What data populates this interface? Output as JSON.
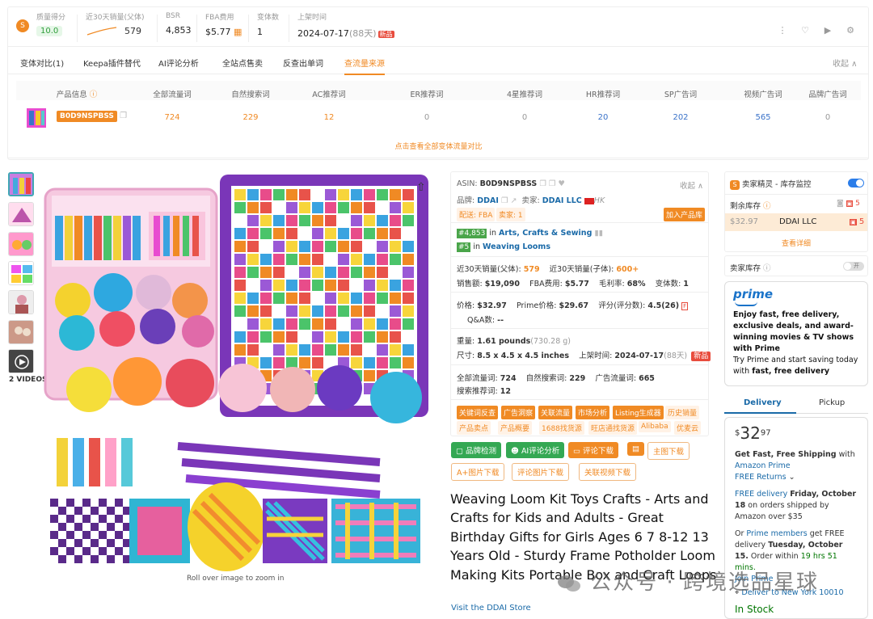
{
  "topbar": {
    "quality_label": "质量得分",
    "quality_value": "10.0",
    "sales_label": "近30天销量(父体)",
    "sales_value": "579",
    "bsr_label": "BSR",
    "bsr_value": "4,853",
    "fba_label": "FBA费用",
    "fba_value": "$5.77",
    "variants_label": "变体数",
    "variants_value": "1",
    "launch_label": "上架时间",
    "launch_value": "2024-07-17",
    "launch_days": "(88天)",
    "new_tag": "新品"
  },
  "tabs": [
    {
      "label": "变体对比(1)"
    },
    {
      "label": "Keepa插件替代"
    },
    {
      "label": "AI评论分析"
    },
    {
      "label": "全站点售卖"
    },
    {
      "label": "反查出单词"
    },
    {
      "label": "查流量来源"
    }
  ],
  "collapse_label": "收起",
  "traffic": {
    "headers": [
      "产品信息",
      "全部流量词",
      "自然搜索词",
      "AC推荐词",
      "ER推荐词",
      "4星推荐词",
      "HR推荐词",
      "SP广告词",
      "视频广告词",
      "品牌广告词"
    ],
    "asin": "B0D9NSPBSS",
    "values": [
      "724",
      "229",
      "12",
      "0",
      "0",
      "20",
      "202",
      "565",
      "0"
    ],
    "view_all": "点击查看全部变体流量对比"
  },
  "thumbs": {
    "video_label": "2 VIDEOS"
  },
  "image_caption": "Roll over image to zoom in",
  "info": {
    "asin_label": "ASIN:",
    "asin": "B0D9NSPBSS",
    "collapse": "收起",
    "brand_label": "品牌:",
    "brand": "DDAI",
    "seller_label": "卖家:",
    "seller": "DDAI LLC",
    "seller_region": "HK",
    "ship_tag": "配送: FBA",
    "sellers_tag": "卖家: 1",
    "add_product": "加入产品库",
    "rank1": "#4,853",
    "rank1_in": "in",
    "rank1_cat": "Arts, Crafts & Sewing",
    "rank2": "#5",
    "rank2_in": "in",
    "rank2_cat": "Weaving Looms",
    "sales_parent_label": "近30天销量(父体):",
    "sales_parent": "579",
    "sales_child_label": "近30天销量(子体):",
    "sales_child": "600+",
    "revenue_label": "销售额:",
    "revenue": "$19,090",
    "fba_label": "FBA费用:",
    "fba": "$5.77",
    "margin_label": "毛利率:",
    "margin": "68%",
    "variants_label": "变体数:",
    "variants": "1",
    "price_label": "价格:",
    "price": "$32.97",
    "prime_price_label": "Prime价格:",
    "prime_price": "$29.67",
    "rating_label": "评分(评分数):",
    "rating": "4.5(26)",
    "qa_label": "Q&A数:",
    "qa": "--",
    "weight_label": "重量:",
    "weight": "1.61 pounds",
    "weight_g": "(730.28 g)",
    "size_label": "尺寸:",
    "size": "8.5 x 4.5 x 4.5 inches",
    "launch_label": "上架时间:",
    "launch": "2024-07-17",
    "launch_days": "(88天)",
    "new_tag": "新品",
    "all_kw_label": "全部流量词:",
    "all_kw": "724",
    "organic_label": "自然搜索词:",
    "organic": "229",
    "ad_label": "广告流量词:",
    "ad": "665",
    "rec_label": "搜索推荐词:",
    "rec": "12",
    "tools_row1": [
      "关键词反查",
      "广告洞察",
      "关联流量",
      "市场分析",
      "Listing生成器",
      "历史销量"
    ],
    "tools_row2": [
      "产品卖点",
      "产品概要",
      "1688找货源",
      "旺店通找货源",
      "Alibaba",
      "优麦云"
    ]
  },
  "actions": {
    "brand_check": "品牌检测",
    "ai_review": "AI评论分析",
    "review_dl": "评论下载",
    "main_img_dl": "主图下载",
    "aplus_dl": "A+图片下载",
    "review_img_dl": "评论图片下载",
    "video_dl": "关联视频下载"
  },
  "product_title": "Weaving Loom Kit Toys Crafts - Arts and Crafts for Kids and Adults - Great Birthday Gifts for Girls Ages 6 7 8-12 13 Years Old - Sturdy Frame Potholder Loom Making Kits Portable Box and Craft Loops",
  "store_link": "Visit the DDAI Store",
  "right": {
    "monitor_label": "卖家精灵 - 库存监控",
    "stock_label": "剩余库存",
    "stock_count": "5",
    "row_price": "$32.97",
    "row_seller": "DDAI LLC",
    "row_count": "5",
    "view_detail": "查看详细",
    "seller_stock_label": "卖家库存",
    "toggle_label": "开"
  },
  "prime": {
    "logo": "prime",
    "line1": "Enjoy fast, free delivery, exclusive deals, and award-winning movies & TV shows with Prime",
    "line2": "Try Prime and start saving today with",
    "line2_bold": "fast, free delivery"
  },
  "buybox": {
    "tab_delivery": "Delivery",
    "tab_pickup": "Pickup",
    "currency": "$",
    "price_whole": "32",
    "price_frac": "97",
    "free_ship": "Get Fast, Free Shipping",
    "with": "with",
    "amazon_prime": "Amazon Prime",
    "free_returns": "FREE Returns",
    "free_delivery": "FREE delivery",
    "date1": "Friday, October 18",
    "ship_cond": "on orders shipped by Amazon over $35",
    "or": "Or",
    "prime_members": "Prime members",
    "get_free": "get FREE delivery",
    "date2": "Tuesday, October 15.",
    "order_within": "Order within",
    "countdown": "19 hrs 51 mins.",
    "join_prime": "Join Prime",
    "deliver_to": "Deliver to New York 10010",
    "in_stock": "In Stock"
  },
  "watermark": "公众号 · 跨境选品星球"
}
